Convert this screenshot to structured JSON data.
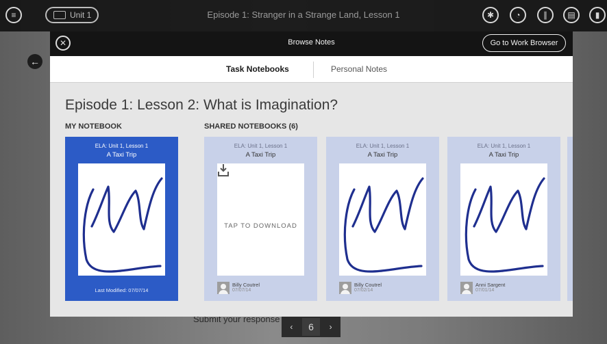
{
  "app": {
    "episode_title": "Episode 1: Stranger in a Strange Land, Lesson 1",
    "unit_button": "Unit 1",
    "bottom_prompt": "Submit your response",
    "pager": {
      "prev": "‹",
      "current": "6",
      "next": "›"
    }
  },
  "modal": {
    "close_icon": "close-icon",
    "title": "Browse Notes",
    "work_browser_button": "Go to Work Browser",
    "tabs": [
      {
        "label": "Task Notebooks",
        "active": true
      },
      {
        "label": "Personal Notes",
        "active": false
      }
    ],
    "lesson_title": "Episode 1: Lesson 2: What is Imagination?",
    "my_notebook": {
      "section_label": "MY NOTEBOOK",
      "card": {
        "subtitle": "ELA: Unit 1, Lesson 1",
        "title": "A Taxi Trip",
        "last_modified": "Last Modified: 07/07/14"
      }
    },
    "shared": {
      "section_label": "SHARED NOTEBOOKS (6)",
      "cards": [
        {
          "subtitle": "ELA: Unit 1, Lesson 1",
          "title": "A Taxi Trip",
          "download_text": "TAP TO DOWNLOAD",
          "author": "Billy Coutrel",
          "date": "07/07/14"
        },
        {
          "subtitle": "ELA: Unit 1, Lesson 1",
          "title": "A Taxi Trip",
          "author": "Billy Coutrel",
          "date": "07/02/14"
        },
        {
          "subtitle": "ELA: Unit 1, Lesson 1",
          "title": "A Taxi Trip",
          "author": "Anni Sargent",
          "date": "07/01/14"
        }
      ]
    }
  },
  "colors": {
    "my_card_bg": "#2c5bc6",
    "shared_card_bg": "#c8d1e9",
    "scribble_stroke": "#1f2f8f"
  },
  "icons": {
    "menu": "hamburger-menu-icon",
    "keyboard": "keyboard-icon",
    "top_right": [
      "palette-icon",
      "compass-icon",
      "library-icon",
      "notes-icon",
      "clipboard-icon"
    ],
    "back": "back-arrow-icon",
    "download": "download-icon",
    "avatar": "avatar-icon"
  }
}
